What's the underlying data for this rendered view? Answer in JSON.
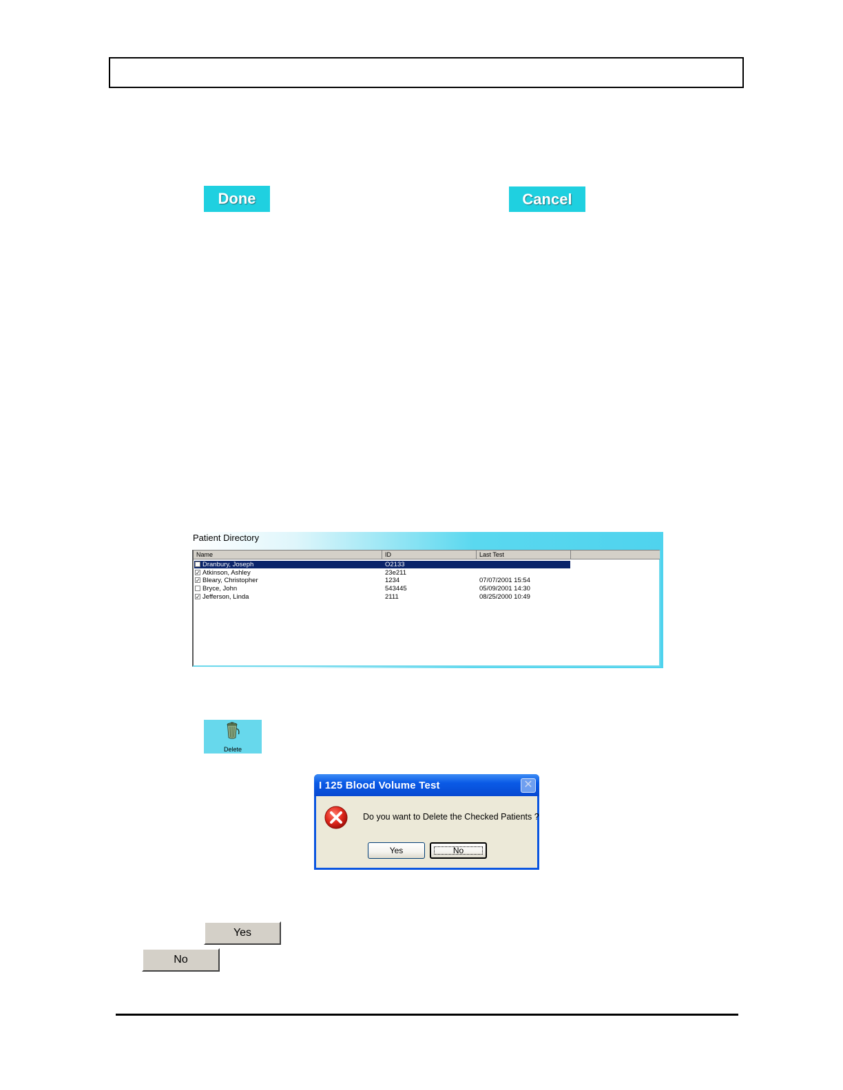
{
  "header_box": {
    "text": ""
  },
  "buttons": {
    "done_label": "Done",
    "cancel_label": "Cancel"
  },
  "patient_directory": {
    "title": "Patient Directory",
    "columns": [
      "Name",
      "ID",
      "Last Test"
    ],
    "rows": [
      {
        "checked": false,
        "selected": true,
        "name": "Dranbury, Joseph",
        "id": "O2133",
        "last_test": ""
      },
      {
        "checked": true,
        "selected": false,
        "name": "Atkinson, Ashley",
        "id": "23e211",
        "last_test": ""
      },
      {
        "checked": true,
        "selected": false,
        "name": "Bleary, Christopher",
        "id": "1234",
        "last_test": "07/07/2001   15:54"
      },
      {
        "checked": false,
        "selected": false,
        "name": "Bryce, John",
        "id": "543445",
        "last_test": "05/09/2001   14:30"
      },
      {
        "checked": true,
        "selected": false,
        "name": "Jefferson, Linda",
        "id": "2111",
        "last_test": "08/25/2000   10:49"
      }
    ]
  },
  "delete_button": {
    "label": "Delete",
    "icon": "trash-can-icon"
  },
  "dialog": {
    "title": "I 125 Blood Volume Test",
    "message": "Do you want to Delete the Checked Patients ?",
    "yes_label": "Yes",
    "no_label": "No",
    "icon": "error-icon"
  },
  "standalone_buttons": {
    "yes_label": "Yes",
    "no_label": "No"
  },
  "colors": {
    "cyan_button": "#1fd0e0",
    "selection": "#0a246a",
    "xp_title_blue": "#0a5ae6"
  }
}
